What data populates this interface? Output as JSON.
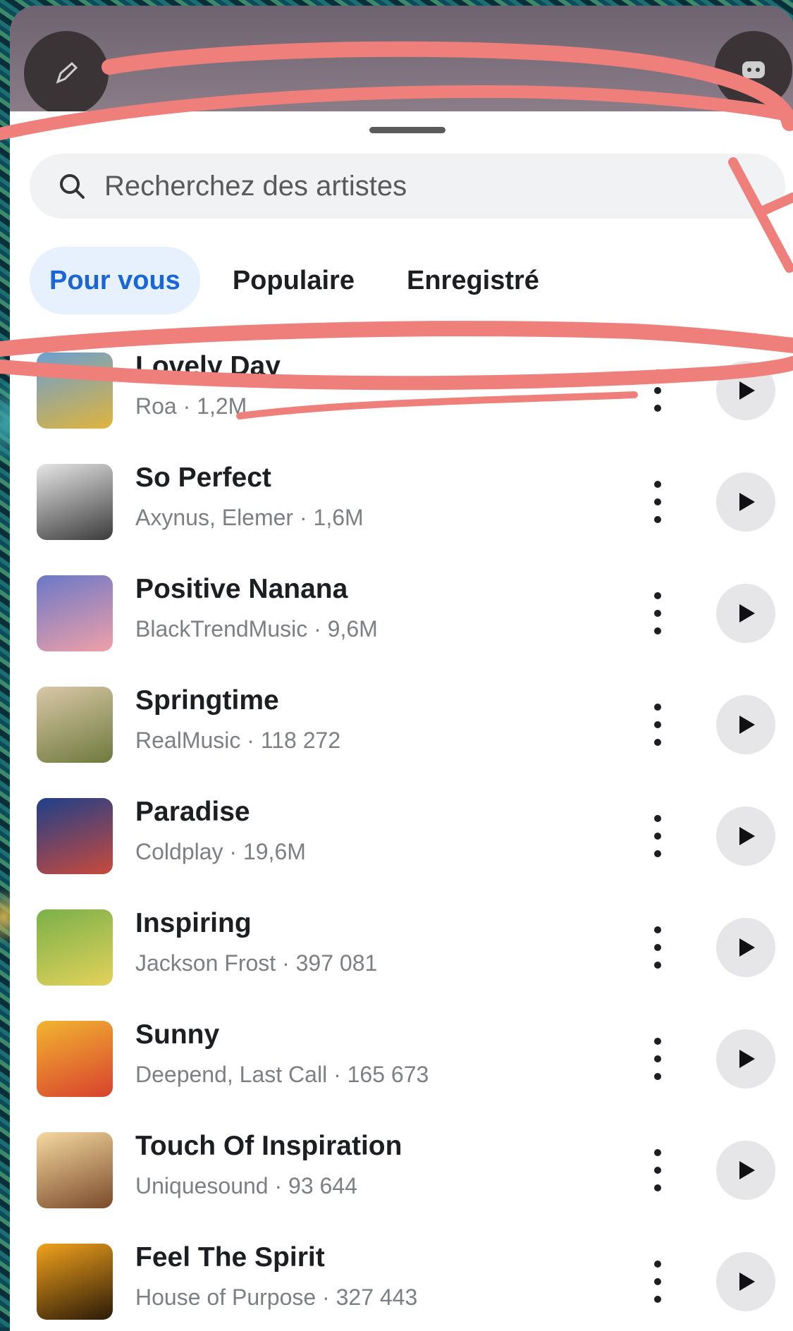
{
  "search": {
    "placeholder": "Recherchez des artistes"
  },
  "tabs": [
    {
      "label": "Pour vous",
      "active": true
    },
    {
      "label": "Populaire",
      "active": false
    },
    {
      "label": "Enregistré",
      "active": false
    }
  ],
  "tracks": [
    {
      "title": "Lovely Day",
      "subtitle": "Roa · 1,2M",
      "thumb": [
        "#6a9fd0",
        "#e0b43c"
      ]
    },
    {
      "title": "So Perfect",
      "subtitle": "Axynus, Elemer · 1,6M",
      "thumb": [
        "#e6e6e6",
        "#3b3b3b"
      ]
    },
    {
      "title": "Positive Nanana",
      "subtitle": "BlackTrendMusic · 9,6M",
      "thumb": [
        "#6a78c8",
        "#f0a0a8"
      ]
    },
    {
      "title": "Springtime",
      "subtitle": "RealMusic · 118 272",
      "thumb": [
        "#d9c7a8",
        "#6e7a3c"
      ]
    },
    {
      "title": "Paradise",
      "subtitle": "Coldplay · 19,6M",
      "thumb": [
        "#1e3f8a",
        "#c94a3c"
      ]
    },
    {
      "title": "Inspiring",
      "subtitle": "Jackson Frost · 397 081",
      "thumb": [
        "#7ab04a",
        "#e3d25a"
      ]
    },
    {
      "title": "Sunny",
      "subtitle": "Deepend, Last Call · 165 673",
      "thumb": [
        "#f2b531",
        "#d8412e"
      ]
    },
    {
      "title": "Touch Of Inspiration",
      "subtitle": "Uniquesound · 93 644",
      "thumb": [
        "#f5d8a0",
        "#7a4a2a"
      ]
    },
    {
      "title": "Feel The Spirit",
      "subtitle": "House of Purpose · 327 443",
      "thumb": [
        "#f2a21c",
        "#2a1a08"
      ]
    }
  ],
  "colors": {
    "accent": "#1a66d6",
    "tab_active_bg": "#e7f0fd",
    "annotation": "#ef7f7a"
  }
}
